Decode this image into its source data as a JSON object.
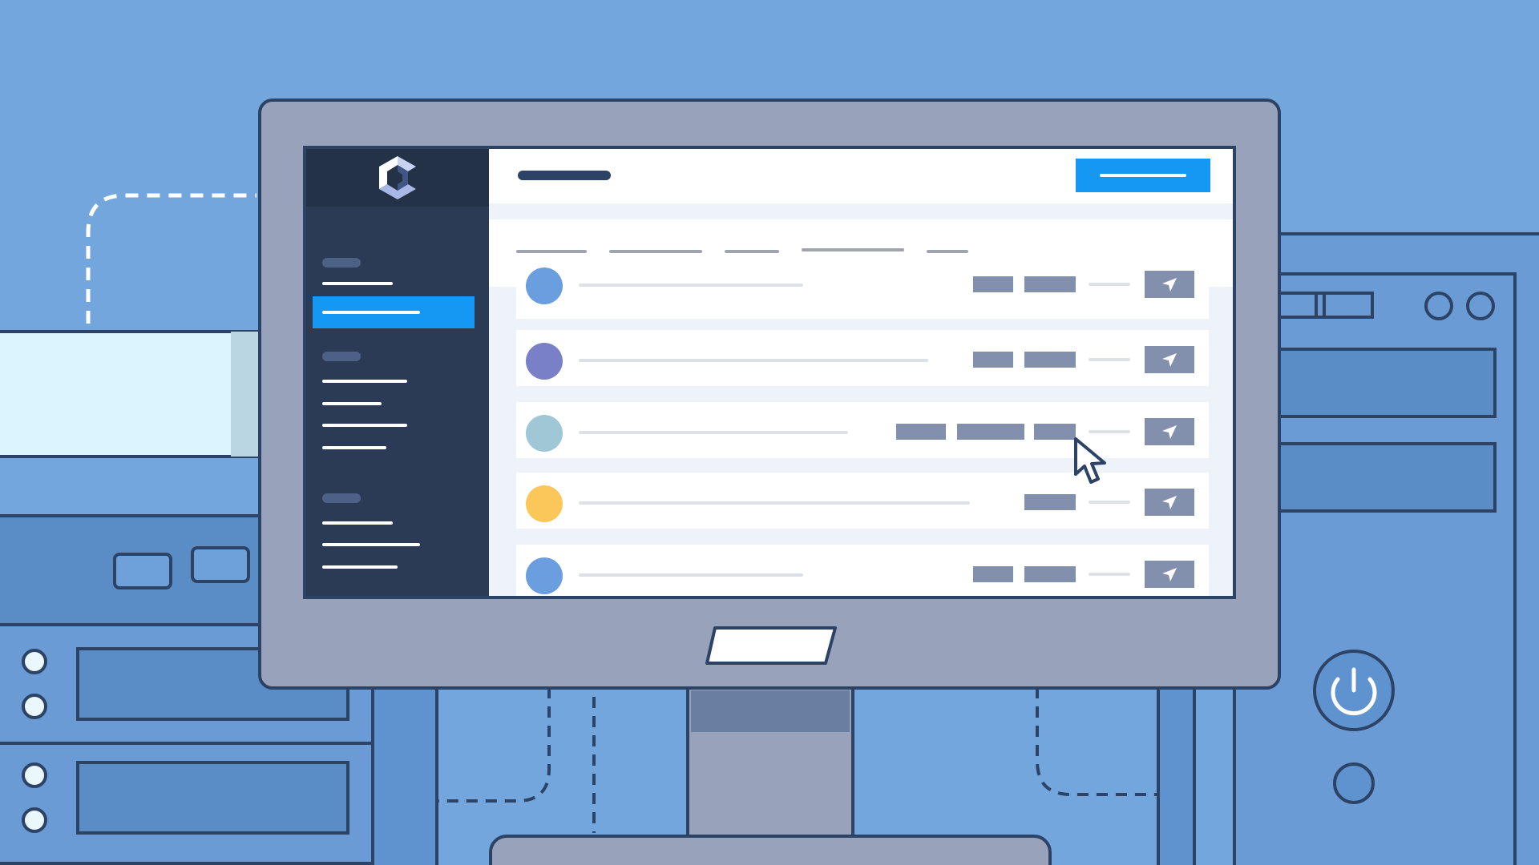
{
  "colors": {
    "background": "#74a6de",
    "accent": "#1598f4",
    "sidebar": "#2b3b55",
    "outline": "#2c4366",
    "bezel": "#98a2bb",
    "chip": "#8290ad"
  },
  "icons": {
    "logo": "c-logo-icon",
    "send": "send-arrow-icon",
    "cursor": "mouse-pointer-icon",
    "power": "power-icon"
  },
  "list": {
    "rows": [
      {
        "avatar_color": "#6b9ede"
      },
      {
        "avatar_color": "#7a80c8"
      },
      {
        "avatar_color": "#9fc7d6"
      },
      {
        "avatar_color": "#fbc75a"
      },
      {
        "avatar_color": "#6b9ede"
      }
    ]
  }
}
